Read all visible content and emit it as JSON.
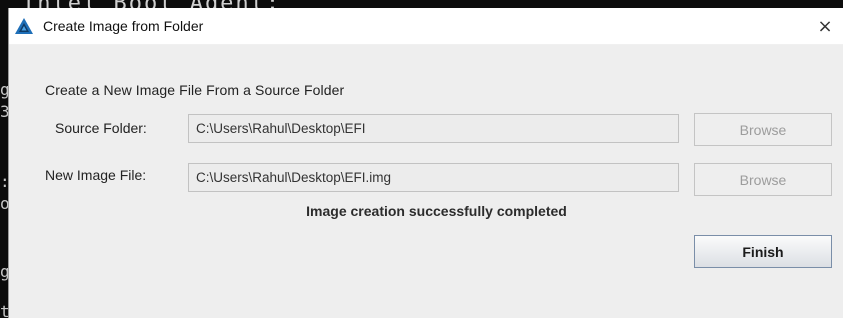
{
  "background_console": {
    "text": "Intel Boot Agent:",
    "side_chars": [
      "g",
      "3",
      ":",
      "o",
      "g",
      "t"
    ]
  },
  "dialog": {
    "title": "Create Image from Folder",
    "close_glyph": "×",
    "heading": "Create a New Image File From a Source Folder",
    "source_folder": {
      "label": "Source Folder:",
      "value": "C:\\Users\\Rahul\\Desktop\\EFI",
      "browse_label": "Browse"
    },
    "new_image_file": {
      "label": "New Image File:",
      "value": "C:\\Users\\Rahul\\Desktop\\EFI.img",
      "browse_label": "Browse"
    },
    "status_text": "Image creation successfully completed",
    "finish_label": "Finish"
  },
  "icons": {
    "app_icon": "triangle-logo-icon",
    "close_icon": "close-icon"
  },
  "colors": {
    "app_icon_blue": "#1e6fb8",
    "app_icon_dark": "#0f3b66",
    "primary_button_border": "#7a8ea8"
  }
}
